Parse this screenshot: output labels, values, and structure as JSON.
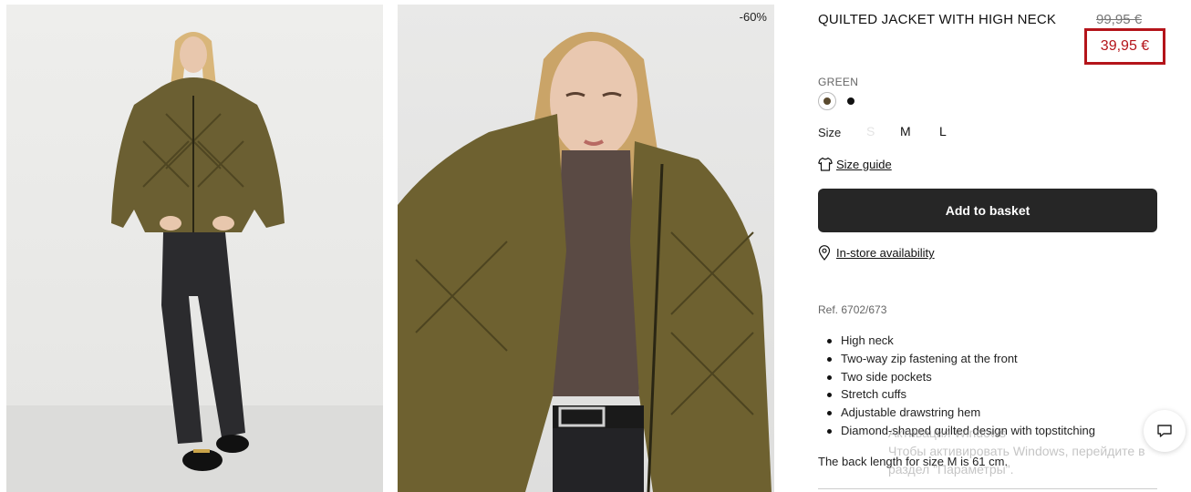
{
  "product": {
    "title": "QUILTED JACKET WITH HIGH NECK",
    "old_price": "99,95 €",
    "new_price": "39,95 €",
    "discount_badge": "-60%",
    "color_name": "GREEN",
    "colors": [
      {
        "name": "green",
        "hex": "#5a4a2e",
        "selected": true
      },
      {
        "name": "black",
        "hex": "#111111",
        "selected": false
      }
    ],
    "size_label": "Size",
    "sizes": [
      {
        "label": "S",
        "available": false
      },
      {
        "label": "M",
        "available": true
      },
      {
        "label": "L",
        "available": true
      }
    ],
    "size_guide": "Size guide",
    "add_to_basket": "Add to basket",
    "store_availability": "In-store availability",
    "reference": "Ref. 6702/673",
    "features": [
      "High neck",
      "Two-way zip fastening at the front",
      "Two side pockets",
      "Stretch cuffs",
      "Adjustable drawstring hem",
      "Diamond-shaped quilted design with topstitching"
    ],
    "back_length": "The back length for size M is 61 cm."
  },
  "icons": {
    "tshirt": "tshirt-icon",
    "location": "location-pin-icon",
    "chat": "chat-icon"
  },
  "windows_watermark": {
    "line1": "Активация Windows",
    "line2": "Чтобы активировать Windows, перейдите в",
    "line3": "раздел \"Параметры\"."
  },
  "colors": {
    "sale_red": "#b4141a",
    "button_dark": "#262626"
  }
}
